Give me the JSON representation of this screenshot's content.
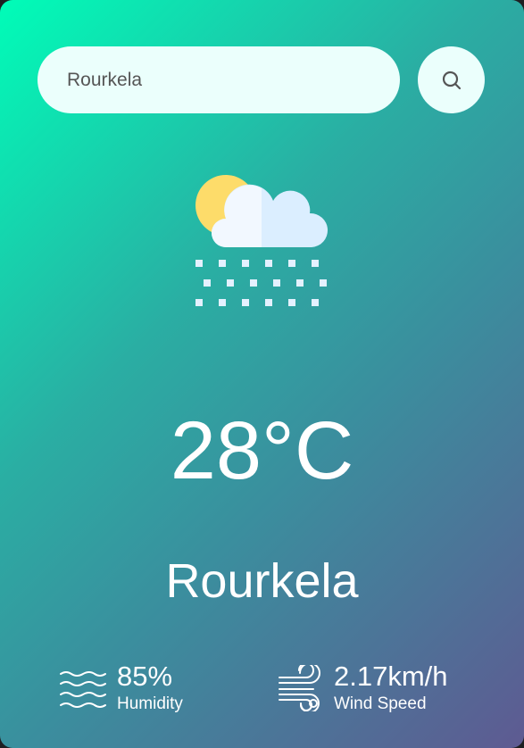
{
  "search": {
    "value": "Rourkela",
    "button_icon": "search-icon"
  },
  "weather": {
    "icon": "snow-cloud-sun-icon",
    "temperature": "28°C",
    "city": "Rourkela"
  },
  "details": {
    "humidity": {
      "icon": "humidity-waves-icon",
      "value": "85%",
      "label": "Humidity"
    },
    "wind": {
      "icon": "wind-icon",
      "value": "2.17km/h",
      "label": "Wind Speed"
    }
  },
  "colors": {
    "gradient_start": "#00fdb8",
    "gradient_end": "#5e5a92",
    "input_background": "#ebfffc",
    "text": "#ffffff"
  }
}
